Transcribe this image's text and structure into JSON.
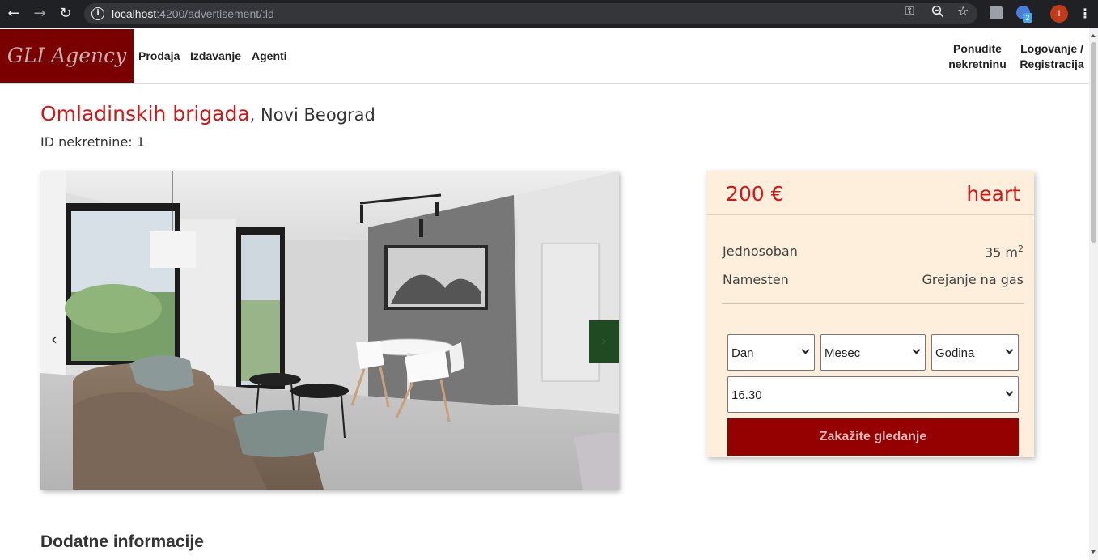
{
  "browser": {
    "url_host": "localhost",
    "url_path": ":4200/advertisement/:id",
    "profile_initial": "I",
    "extension_badge": "2"
  },
  "header": {
    "logo": "GLI Agency",
    "nav": [
      "Prodaja",
      "Izdavanje",
      "Agenti"
    ],
    "offer_line1": "Ponudite",
    "offer_line2": "nekretninu",
    "auth_line1": "Logovanje /",
    "auth_line2": "Registracija"
  },
  "listing": {
    "street": "Omladinskih brigada",
    "city": ", Novi Beograd",
    "id_label": "ID nekretnine: 1"
  },
  "card": {
    "price": "200 €",
    "favorite": "heart",
    "rooms": "Jednosoban",
    "area": "35 m",
    "area_sup": "2",
    "furnishing": "Namesten",
    "heating": "Grejanje na gas",
    "select_day": "Dan",
    "select_month": "Mesec",
    "select_year": "Godina",
    "select_time": "16.30",
    "book_button": "Zakažite gledanje"
  },
  "section": {
    "title": "Dodatne informacije"
  },
  "icons": {
    "back": "arrow-left-icon",
    "forward": "arrow-right-icon",
    "reload": "reload-icon",
    "info": "info-icon",
    "key": "key-icon",
    "zoom": "zoom-icon",
    "star": "star-icon",
    "prev": "chevron-left-icon",
    "next": "chevron-right-icon"
  },
  "colors": {
    "brand": "#7a0000",
    "accent": "#d01818",
    "button": "#950000",
    "card_bg": "#fdefdb"
  }
}
